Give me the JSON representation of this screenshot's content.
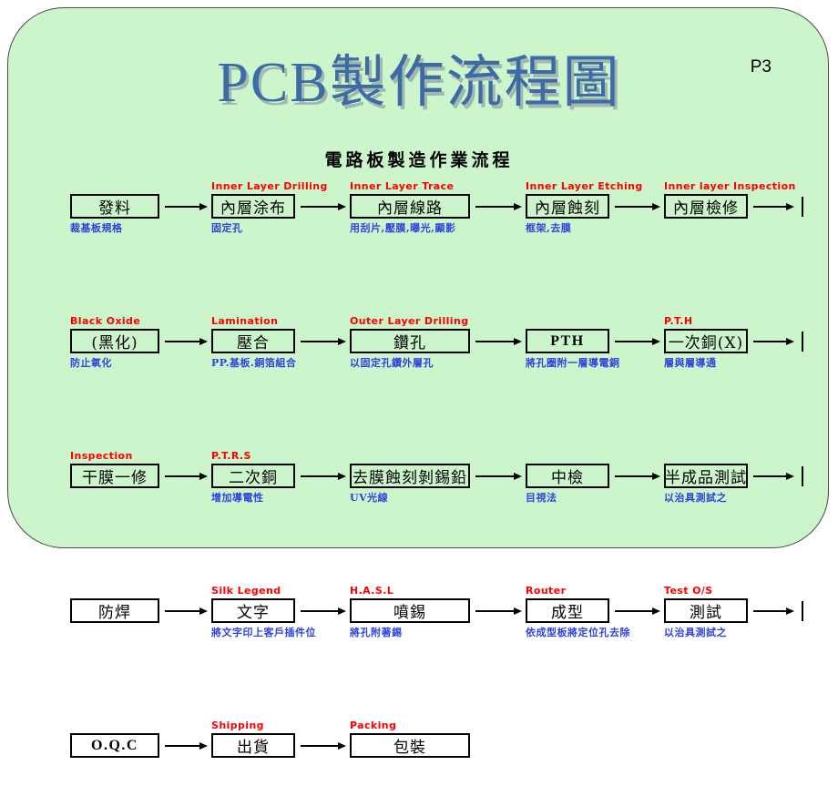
{
  "slide": {
    "title": "PCB製作流程圖",
    "page_marker": "P3",
    "subtitle": "電路板製造作業流程",
    "background_color": "#ccf5cc",
    "title_color": "#3c6ba5",
    "english_label_color": "#ff0000",
    "note_color": "#2f43e0",
    "box_border_color": "#000000"
  },
  "flow": {
    "rows": [
      {
        "steps": [
          {
            "eng": "",
            "name": "發料",
            "note": "裁基板規格",
            "latin": false
          },
          {
            "eng": "Inner Layer Drilling",
            "name": "內層涂布",
            "note": "固定孔",
            "latin": false
          },
          {
            "eng": "Inner Layer Trace",
            "name": "內層線路",
            "note": "用刮片,壓膜,曝光,顯影",
            "latin": false
          },
          {
            "eng": "Inner Layer Etching",
            "name": "內層蝕刻",
            "note": "框架,去膜",
            "latin": false
          },
          {
            "eng": "Inner layer Inspection",
            "name": "內層檢修",
            "note": "",
            "latin": false
          }
        ],
        "continues": true
      },
      {
        "steps": [
          {
            "eng": "Black Oxide",
            "name": "(黑化)",
            "note": "防止氧化",
            "latin": false
          },
          {
            "eng": "Lamination",
            "name": "壓合",
            "note": "PP.基板.銅箔組合",
            "latin": false
          },
          {
            "eng": "Outer Layer Drilling",
            "name": "鑽孔",
            "note": "以固定孔鑽外層孔",
            "latin": false
          },
          {
            "eng": "",
            "name": "PTH",
            "note": "將孔圈附一層導電銅",
            "latin": true
          },
          {
            "eng": "P.T.H",
            "name": "一次銅(X)",
            "note": "層與層導通",
            "latin": false
          }
        ],
        "continues": true
      },
      {
        "steps": [
          {
            "eng": "Inspection",
            "name": "干膜一修",
            "note": "",
            "latin": false
          },
          {
            "eng": "P.T.R.S",
            "name": "二次銅",
            "note": "增加導電性",
            "latin": false
          },
          {
            "eng": "",
            "name": "去膜蝕刻剝錫鉛",
            "note": "UV光線",
            "latin": false
          },
          {
            "eng": "",
            "name": "中檢",
            "note": "目視法",
            "latin": false
          },
          {
            "eng": "",
            "name": "半成品測試",
            "note": "以治具測試之",
            "latin": false
          }
        ],
        "continues": true
      },
      {
        "steps": [
          {
            "eng": "",
            "name": "防焊",
            "note": "",
            "latin": false
          },
          {
            "eng": "Silk Legend",
            "name": "文字",
            "note": "將文字印上客戶插件位",
            "latin": false
          },
          {
            "eng": "H.A.S.L",
            "name": "噴錫",
            "note": "將孔附著錫",
            "latin": false
          },
          {
            "eng": "Router",
            "name": "成型",
            "note": "依成型板將定位孔去除",
            "latin": false
          },
          {
            "eng": "Test  O/S",
            "name": "測試",
            "note": "以治具測試之",
            "latin": false
          }
        ],
        "continues": true
      },
      {
        "steps": [
          {
            "eng": "",
            "name": "O.Q.C",
            "note": "",
            "latin": true
          },
          {
            "eng": "Shipping",
            "name": "出貨",
            "note": "",
            "latin": false
          },
          {
            "eng": "Packing",
            "name": "包裝",
            "note": "",
            "latin": false
          }
        ],
        "continues": false
      }
    ]
  }
}
